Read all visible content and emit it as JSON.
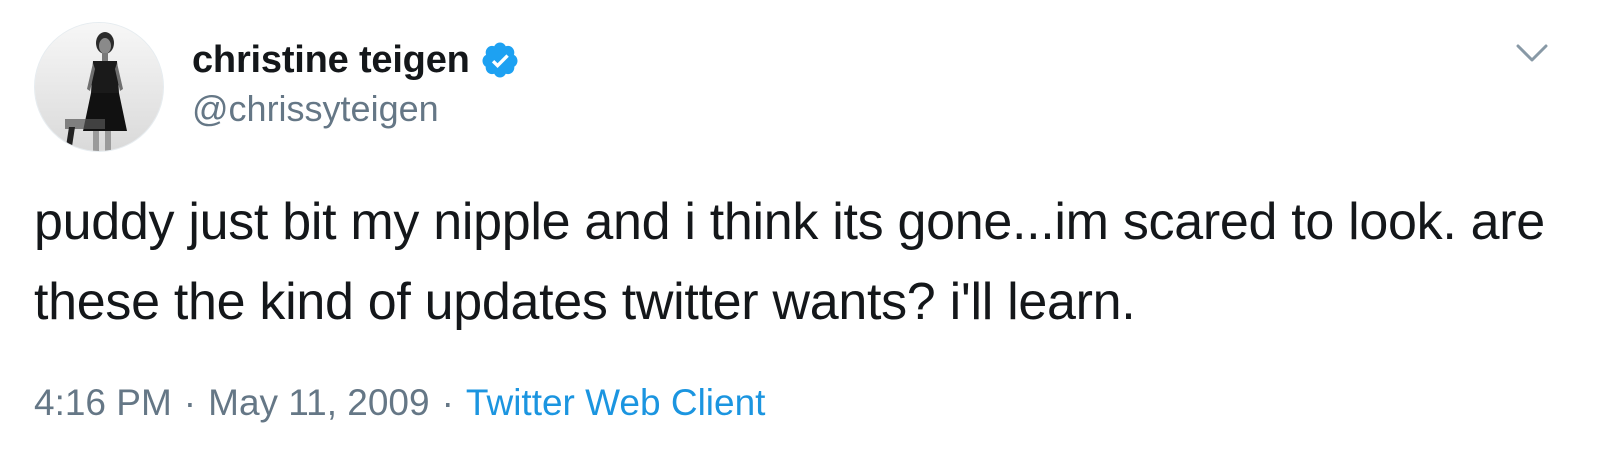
{
  "user": {
    "display_name": "christine teigen",
    "handle": "@chrissyteigen",
    "verified": true,
    "avatar_icon": "profile-photo-avatar"
  },
  "tweet": {
    "text": "puddy just bit my nipple and i think its gone...im scared to look. are these the kind of updates twitter wants? i'll learn.",
    "time": "4:16 PM",
    "separator": "·",
    "date": "May 11, 2009",
    "source": "Twitter Web Client"
  },
  "icons": {
    "verified": "verified-badge-icon",
    "menu": "chevron-down-icon"
  },
  "colors": {
    "text_primary": "#14171a",
    "text_secondary": "#657786",
    "link": "#1b95e0",
    "verified_blue": "#1da1f2"
  }
}
